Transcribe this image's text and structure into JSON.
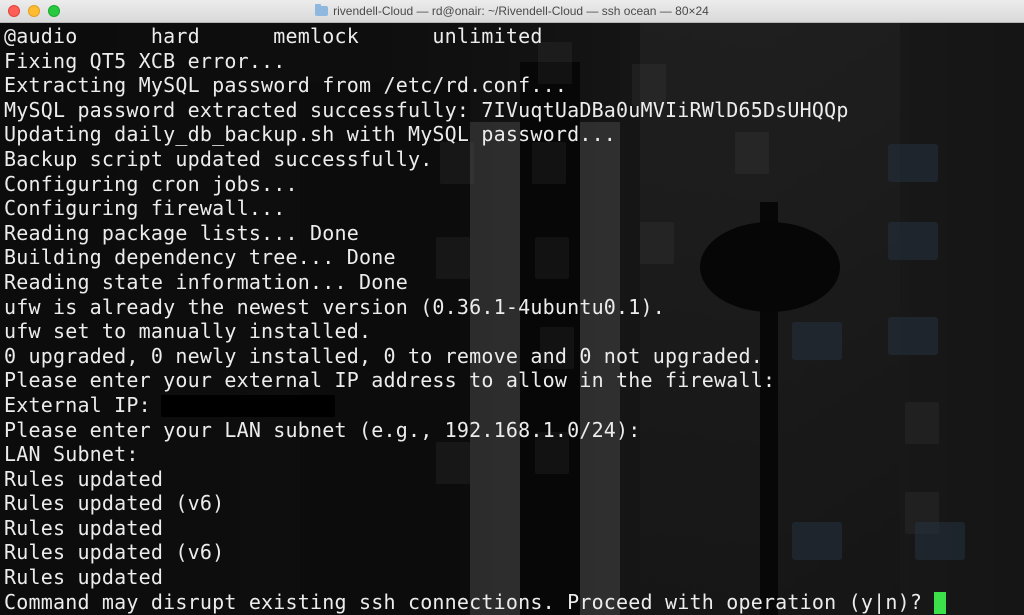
{
  "window": {
    "title": "rivendell-Cloud — rd@onair: ~/Rivendell-Cloud — ssh ocean — 80×24"
  },
  "terminal": {
    "lines": [
      "@audio      hard      memlock      unlimited",
      "Fixing QT5 XCB error...",
      "Extracting MySQL password from /etc/rd.conf...",
      "MySQL password extracted successfully: 7IVuqtUaDBa0uMVIiRWlD65DsUHQQp",
      "Updating daily_db_backup.sh with MySQL password...",
      "Backup script updated successfully.",
      "Configuring cron jobs...",
      "Configuring firewall...",
      "Reading package lists... Done",
      "Building dependency tree... Done",
      "Reading state information... Done",
      "ufw is already the newest version (0.36.1-4ubuntu0.1).",
      "ufw set to manually installed.",
      "0 upgraded, 0 newly installed, 0 to remove and 0 not upgraded.",
      "Please enter your external IP address to allow in the firewall:",
      "External IP:",
      "Please enter your LAN subnet (e.g., 192.168.1.0/24):",
      "LAN Subnet:",
      "Rules updated",
      "Rules updated (v6)",
      "Rules updated",
      "Rules updated (v6)",
      "Rules updated",
      "Command may disrupt existing ssh connections. Proceed with operation (y|n)?"
    ],
    "cursor_color": "#3ce04a"
  }
}
